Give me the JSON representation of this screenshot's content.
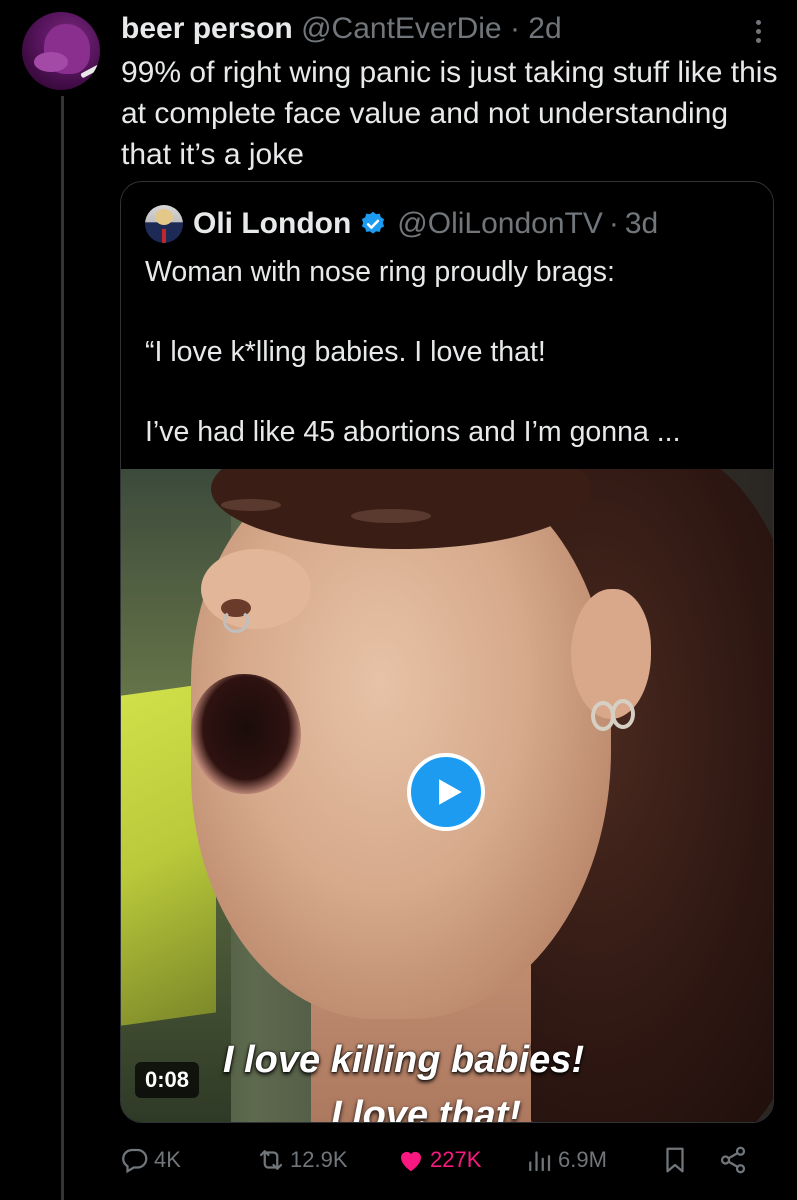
{
  "tweet": {
    "author_name": "beer person",
    "author_handle": "@CantEverDie",
    "separator": "·",
    "time": "2d",
    "text": "99% of right wing panic is just taking stuff like this at complete face value and not understanding that it’s a joke"
  },
  "quoted_tweet": {
    "author_name": "Oli London",
    "author_handle": "@OliLondonTV",
    "separator": "·",
    "time": "3d",
    "lines": [
      "Woman with nose ring proudly brags:",
      "“I love k*lling babies. I love that!",
      "I’ve had like 45 abortions and I’m gonna ..."
    ],
    "video": {
      "duration": "0:08",
      "caption": "I love killing babies!",
      "caption_partial": "I love that!"
    }
  },
  "actions": {
    "replies": "4K",
    "reposts": "12.9K",
    "likes": "227K",
    "views": "6.9M"
  },
  "colors": {
    "accent": "#1d9bf0",
    "like": "#f91880",
    "muted": "#71767b",
    "text": "#e7e9ea"
  }
}
